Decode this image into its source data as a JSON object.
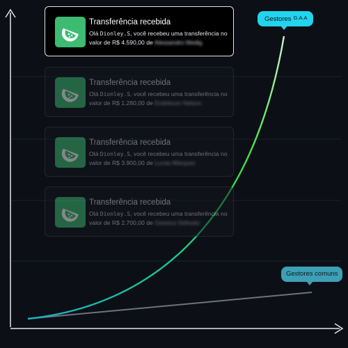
{
  "colors": {
    "background": "#0c0f15",
    "card_bg": "#12161d",
    "card_active_bg": "#000000",
    "card_border": "#3a4048",
    "card_active_border": "#dfe3e8",
    "brand_green": "#3dbb73",
    "curve_start": "#1ab0c8",
    "curve_end": "#c9f5c9",
    "gaa_bubble": "#22d4ee",
    "comum_bubble": "#3da0b4",
    "axis": "#e6e6e6"
  },
  "notifications": [
    {
      "icon": "lime-slice-icon",
      "title": "Transferência recebida",
      "greeting": "Olá",
      "user": "Dionley.S",
      "text_mid": ", você recebeu uma transferência no valor de",
      "amount": "R$ 4.590,00",
      "connector": "de",
      "sender": "Alessandro Medig",
      "active": true
    },
    {
      "icon": "lime-slice-icon",
      "title": "Transferência recebida",
      "greeting": "Olá",
      "user": "Dionley.S",
      "text_mid": ", você recebeu uma transferência no valor de",
      "amount": "R$ 1.280,00",
      "connector": "de",
      "sender": "Endrikson Nelson",
      "active": false
    },
    {
      "icon": "lime-slice-icon",
      "title": "Transferência recebida",
      "greeting": "Olá",
      "user": "Dionley.S",
      "text_mid": ", você recebeu uma transferência no valor de",
      "amount": "R$ 3.900,00",
      "connector": "de",
      "sender": "Lucas Marquez",
      "active": false
    },
    {
      "icon": "lime-slice-icon",
      "title": "Transferência recebida",
      "greeting": "Olá",
      "user": "Dionley.S",
      "text_mid": ", você recebeu uma transferência no valor de",
      "amount": "R$ 2.700,00",
      "connector": "de",
      "sender": "Gessica Selhodo",
      "active": false
    }
  ],
  "labels": {
    "gaa_prefix": "Gestores",
    "gaa_suffix": "G.A.A",
    "comum": "Gestores comuns"
  }
}
